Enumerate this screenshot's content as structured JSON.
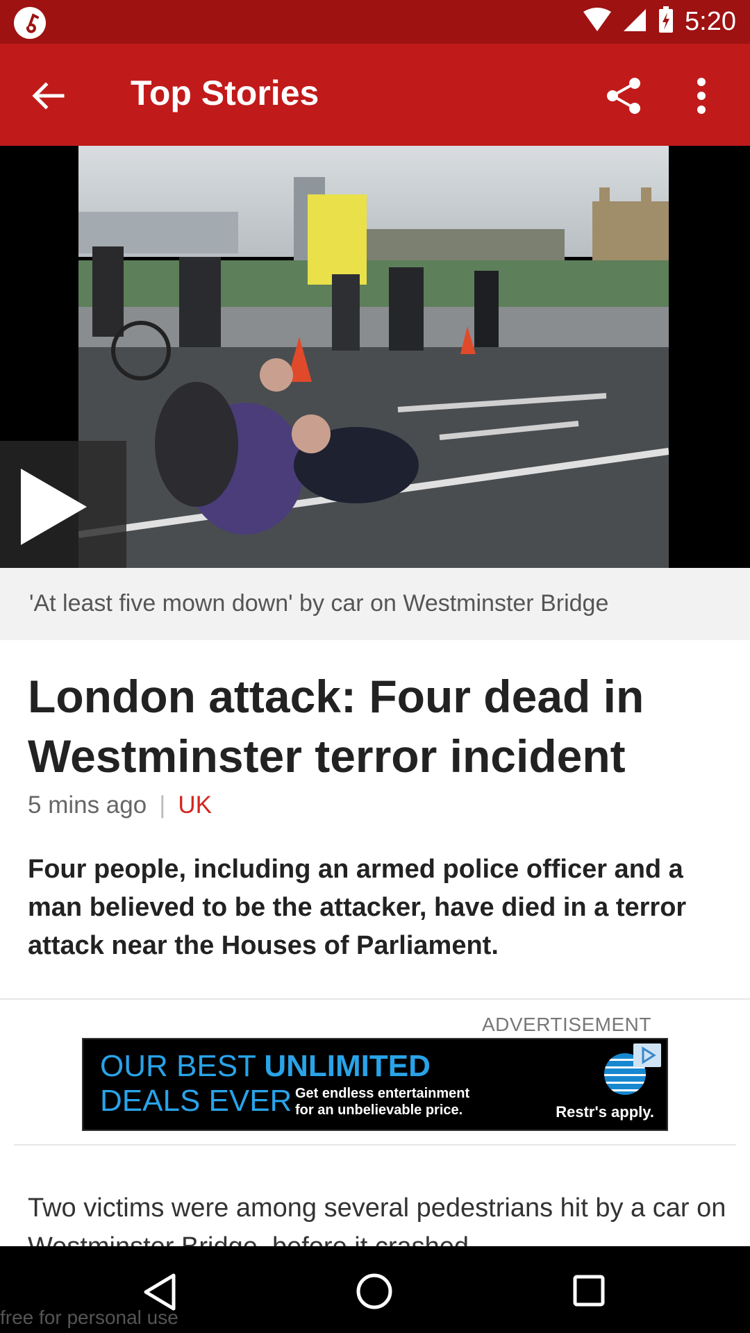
{
  "status_bar": {
    "time": "5:20",
    "icons": [
      "app-notification-icon",
      "wifi-icon",
      "signal-icon",
      "battery-charging-icon"
    ]
  },
  "app_bar": {
    "title": "Top Stories",
    "icons": [
      "back-arrow-icon",
      "share-icon",
      "more-vert-icon"
    ]
  },
  "video": {
    "caption": "'At least five mown down' by car on Westminster Bridge",
    "play_icon": "play-icon"
  },
  "article": {
    "headline": "London attack: Four dead in Westminster terror incident",
    "time_ago": "5 mins ago",
    "separator": "|",
    "section": "UK",
    "summary": "Four people, including an armed police officer and a man believed to be the attacker, have died in a terror attack near the Houses of Parliament.",
    "body_first": "Two victims were among several pedestrians hit by a car on Westminster Bridge, before it crashed"
  },
  "advertisement": {
    "label": "ADVERTISEMENT",
    "line1_prefix": "OUR BEST ",
    "line1_bold": "UNLIMITED",
    "line2": "DEALS EVER",
    "sub1": "Get endless entertainment",
    "sub2": "for an unbelievable price.",
    "restrictions": "Restr's apply.",
    "brand_icon": "att-globe-icon",
    "colors": {
      "text": "#29a3e8",
      "background": "#000000"
    }
  },
  "nav_bar": {
    "icons": [
      "nav-back-icon",
      "nav-home-icon",
      "nav-recents-icon"
    ]
  },
  "watermark": "free for personal use",
  "colors": {
    "status_bar": "#9e1212",
    "app_bar": "#c11a1a",
    "section_accent": "#d3261f"
  }
}
